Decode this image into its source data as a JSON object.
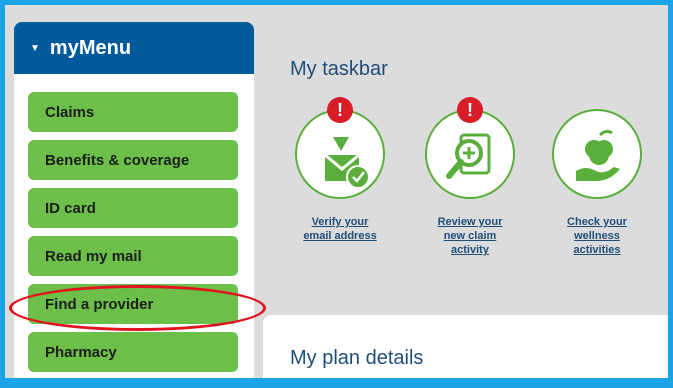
{
  "sidebar": {
    "title": "myMenu",
    "items": [
      {
        "label": "Claims"
      },
      {
        "label": "Benefits & coverage"
      },
      {
        "label": "ID card"
      },
      {
        "label": "Read my mail"
      },
      {
        "label": "Find a provider"
      },
      {
        "label": "Pharmacy"
      }
    ]
  },
  "taskbar": {
    "title": "My taskbar",
    "tasks": [
      {
        "label": "Verify your\nemail address",
        "icon": "email-verify-icon",
        "alert": "!"
      },
      {
        "label": "Review your\nnew claim\nactivity",
        "icon": "claim-review-icon",
        "alert": "!"
      },
      {
        "label": "Check your\nwellness\nactivities",
        "icon": "wellness-apple-icon"
      }
    ]
  },
  "plan": {
    "title": "My plan details"
  },
  "colors": {
    "frame": "#1aa3e6",
    "menu_header": "#005a9c",
    "menu_item": "#6cc04a",
    "alert": "#d71e28",
    "highlight": "#e0141e"
  }
}
